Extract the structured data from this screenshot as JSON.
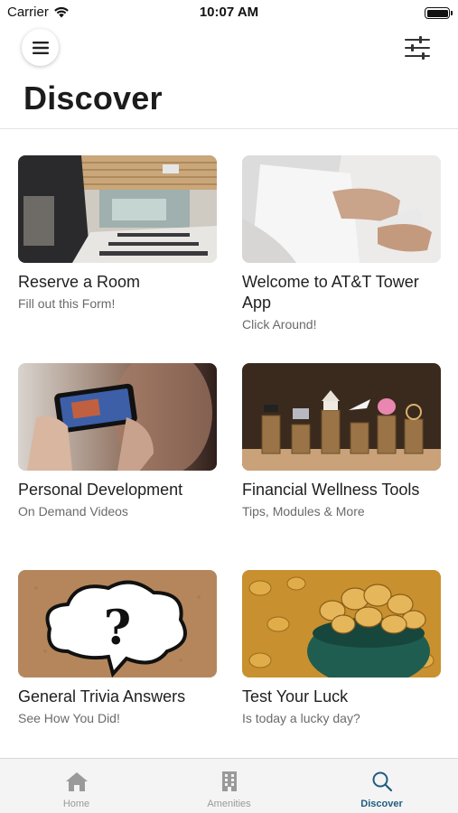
{
  "status_bar": {
    "carrier": "Carrier",
    "time": "10:07 AM"
  },
  "header": {
    "title": "Discover"
  },
  "cards": [
    {
      "title": "Reserve a Room",
      "subtitle": "Fill out this Form!"
    },
    {
      "title": "Welcome to AT&T Tower App",
      "subtitle": "Click Around!"
    },
    {
      "title": "Personal Development",
      "subtitle": "On Demand Videos"
    },
    {
      "title": "Financial Wellness Tools",
      "subtitle": "Tips, Modules & More"
    },
    {
      "title": "General Trivia Answers",
      "subtitle": "See How You Did!"
    },
    {
      "title": "Test Your Luck",
      "subtitle": "Is today a lucky day?"
    }
  ],
  "tab_bar": {
    "tabs": [
      {
        "label": "Home",
        "icon": "home-icon"
      },
      {
        "label": "Amenities",
        "icon": "building-icon"
      },
      {
        "label": "Discover",
        "icon": "search-icon",
        "active": true
      }
    ]
  },
  "colors": {
    "accent": "#1f5c82",
    "inactive_tab": "#9a9a9a"
  }
}
